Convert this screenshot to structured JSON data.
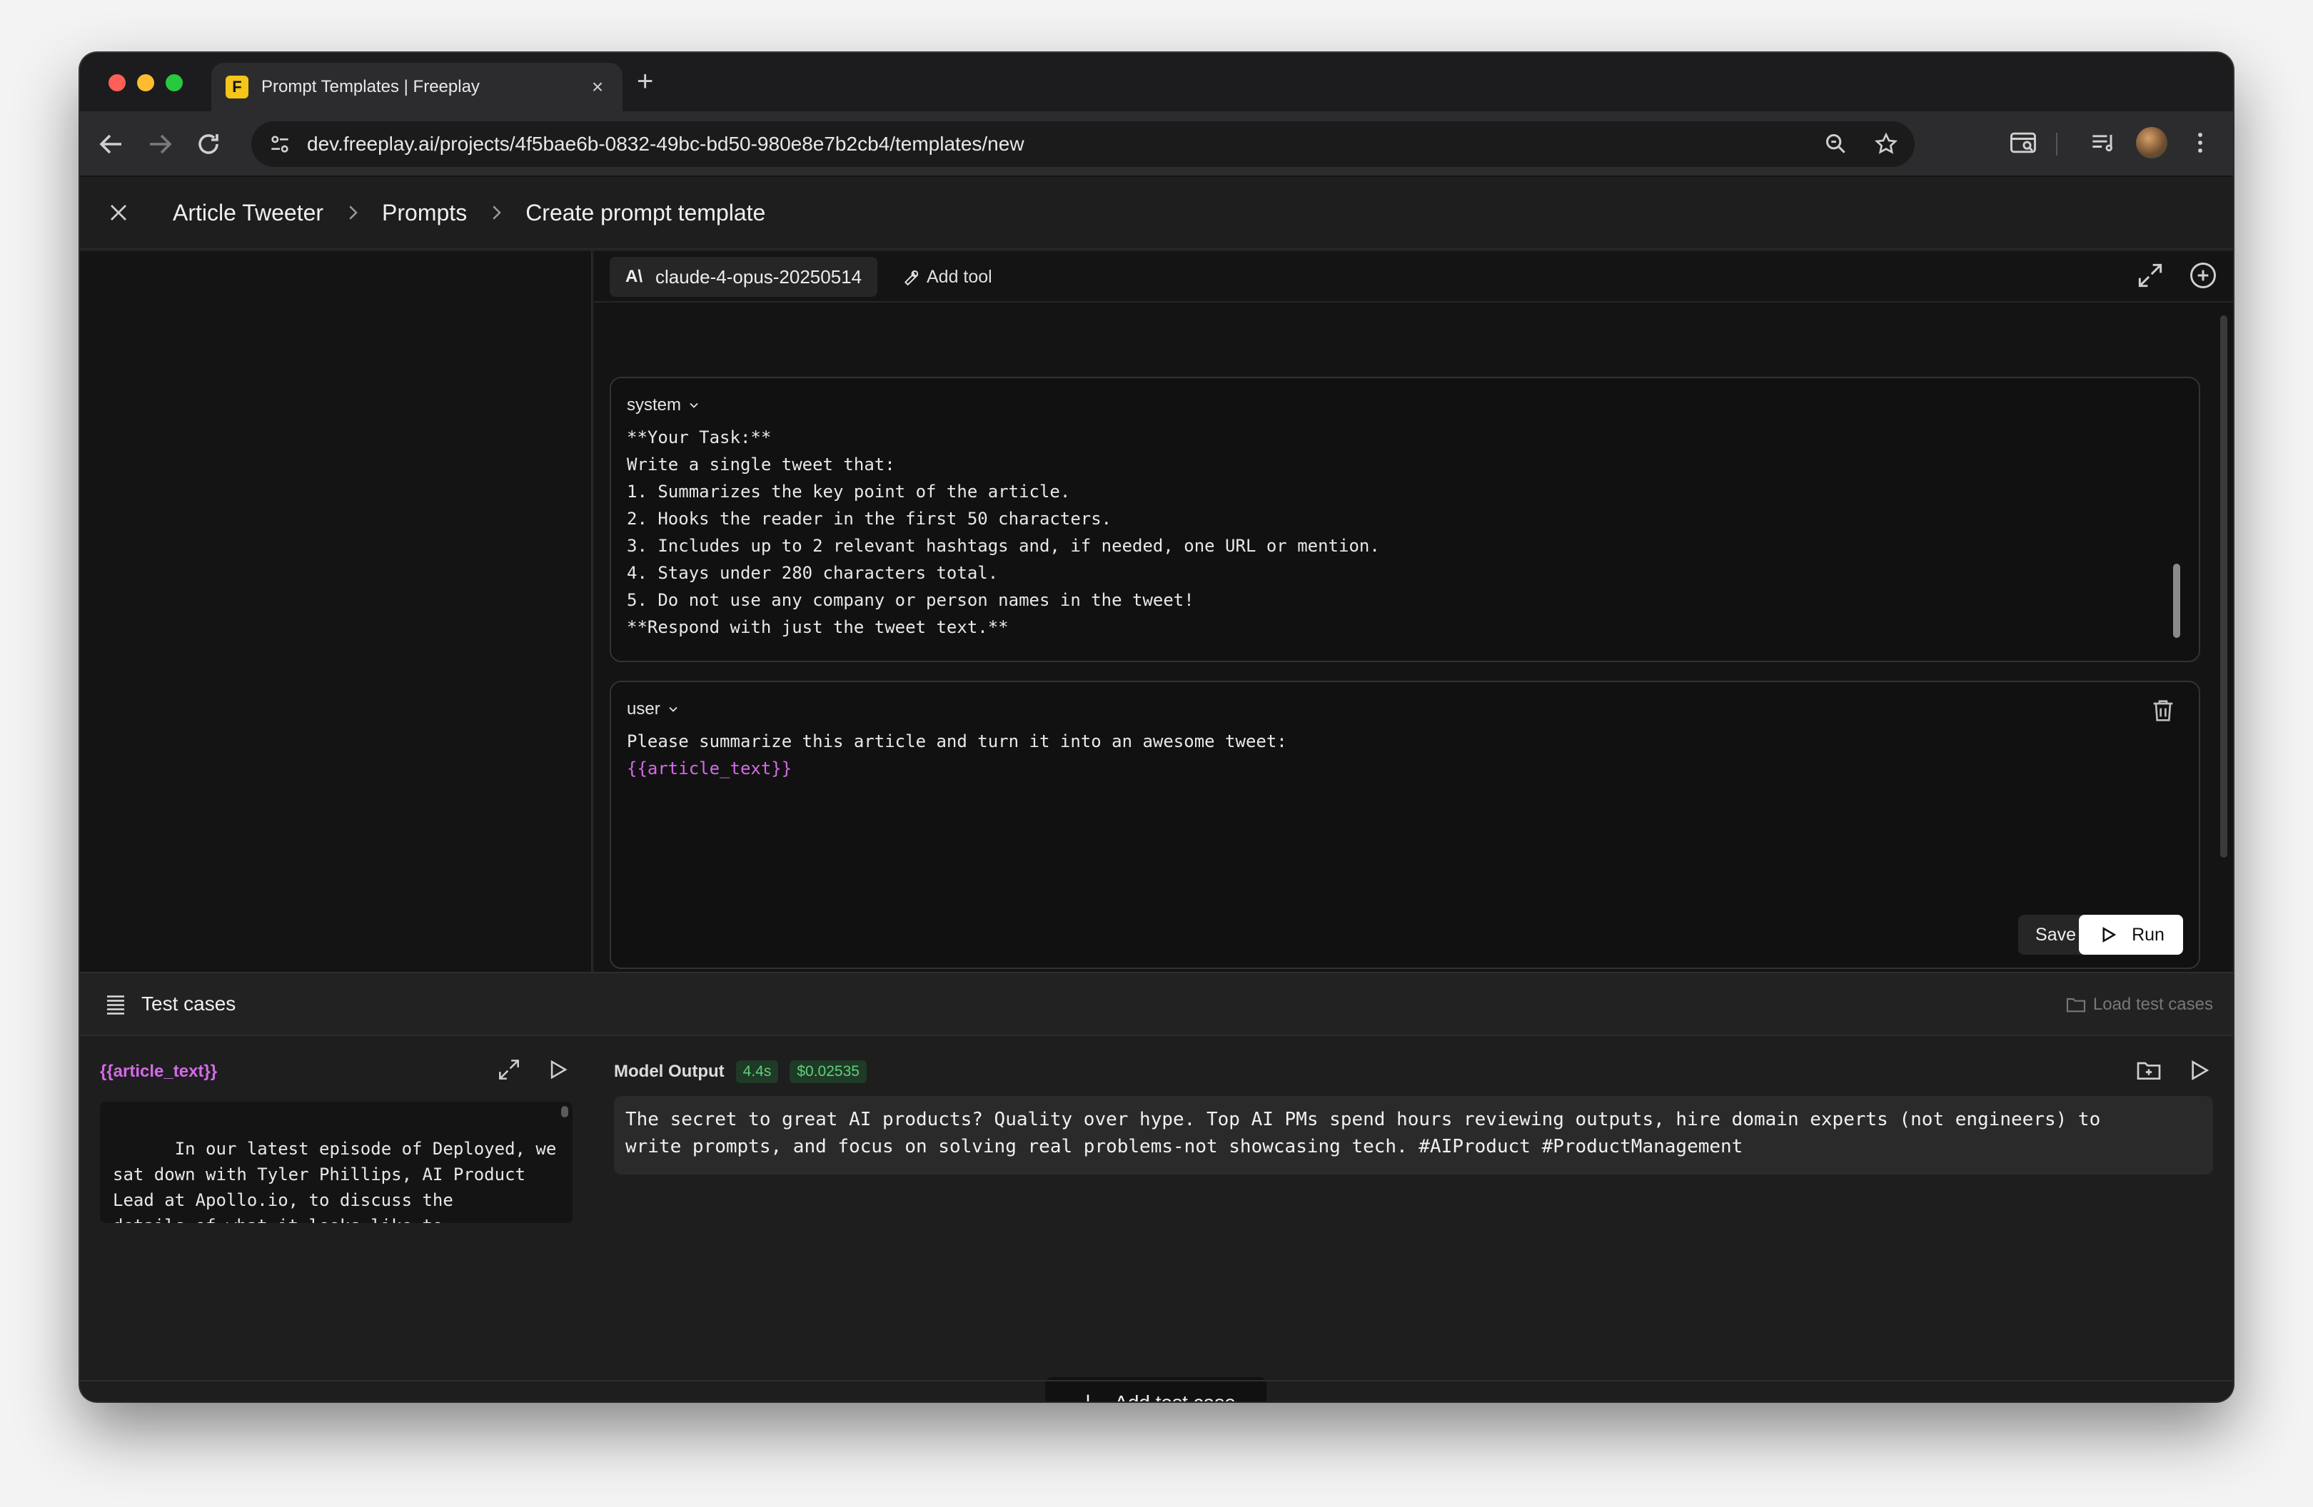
{
  "browser": {
    "tab_title": "Prompt Templates | Freeplay",
    "favicon_letter": "F",
    "url": "dev.freeplay.ai/projects/4f5bae6b-0832-49bc-bd50-980e8e7b2cb4/templates/new"
  },
  "breadcrumb": {
    "items": [
      "Article Tweeter",
      "Prompts",
      "Create prompt template"
    ]
  },
  "editor": {
    "model_logo": "A\\",
    "model": "claude-4-opus-20250514",
    "add_tool_label": "Add tool",
    "system": {
      "role": "system",
      "content": "**Your Task:**\nWrite a single tweet that:\n1. Summarizes the key point of the article.\n2. Hooks the reader in the first 50 characters.\n3. Includes up to 2 relevant hashtags and, if needed, one URL or mention.\n4. Stays under 280 characters total.\n5. Do not use any company or person names in the tweet!\n**Respond with just the tweet text.**"
    },
    "user": {
      "role": "user",
      "content_line1": "Please summarize this article and turn it into an awesome tweet:",
      "variable": "{{article_text}}"
    },
    "save_label": "Save",
    "run_label": "Run"
  },
  "test_cases": {
    "title": "Test cases",
    "load_label": "Load test cases",
    "variable_name": "{{article_text}}",
    "variable_value": "In our latest episode of Deployed, we\nsat down with Tyler Phillips, AI Product\nLead at Apollo.io, to discuss the\ndetails of what it looks like to\nbuilding AI products at a PM at one of",
    "output_label": "Model Output",
    "latency": "4.4s",
    "cost": "$0.02535",
    "output_text": "The secret to great AI products? Quality over hype. Top AI PMs spend hours reviewing outputs, hire domain experts (not engineers) to\nwrite prompts, and focus on solving real problems-not showcasing tech. #AIProduct #ProductManagement",
    "add_label": "Add test case"
  },
  "colors": {
    "accent_variable": "#d36ae8",
    "badge_green": "#5fd07a"
  }
}
